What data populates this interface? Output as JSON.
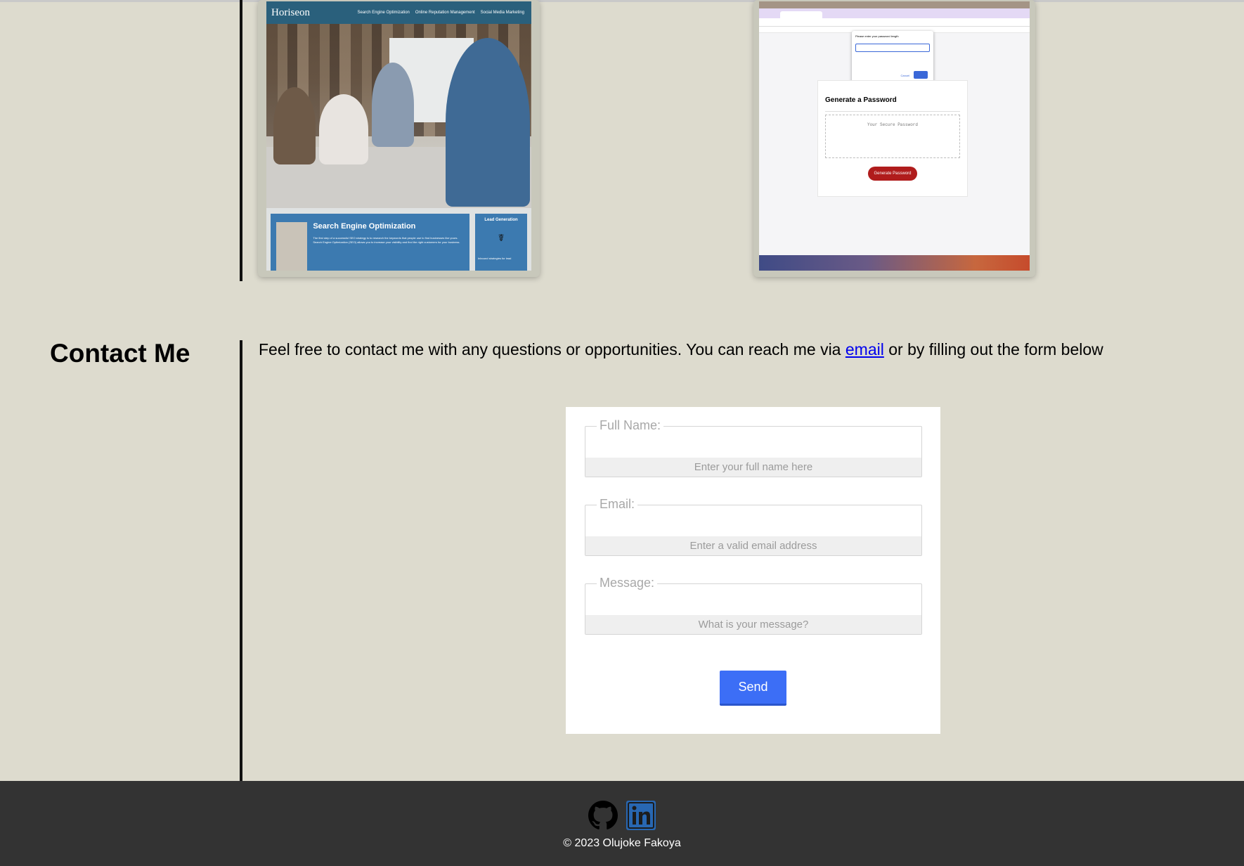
{
  "projects": {
    "horiseon": {
      "logo": "Horiseon",
      "nav": [
        "Search Engine Optimization",
        "Online Reputation Management",
        "Social Media Marketing"
      ],
      "seo_title": "Search Engine Optimization",
      "seo_text": "The first step of a successful SEO strategy is to research the keywords that people use to find businesses like yours. Search Engine Optimization (SEO) allows you to increase your visibility and find the right customers for your business.",
      "lead_title": "Lead Generation",
      "lead_text": "Inbound strategies for lead"
    },
    "password": {
      "dialog_prompt": "Please enter your password length",
      "dialog_cancel": "Cancel",
      "card_title": "Generate a Password",
      "placeholder": "Your Secure Password",
      "button": "Generate Password"
    }
  },
  "contact": {
    "heading": "Contact Me",
    "intro_before": "Feel free to contact me with any questions or opportunities. You can reach me via ",
    "intro_link": "email",
    "intro_after": " or by filling out the form below",
    "fields": {
      "name_label": "Full Name:",
      "name_placeholder": "Enter your full name here",
      "email_label": "Email:",
      "email_placeholder": "Enter a valid email address",
      "message_label": "Message:",
      "message_placeholder": "What is your message?"
    },
    "send_label": "Send"
  },
  "footer": {
    "copyright": "© 2023 Olujoke Fakoya",
    "icons": [
      "github-icon",
      "linkedin-icon"
    ],
    "linkedin_color": "#2867b2"
  }
}
